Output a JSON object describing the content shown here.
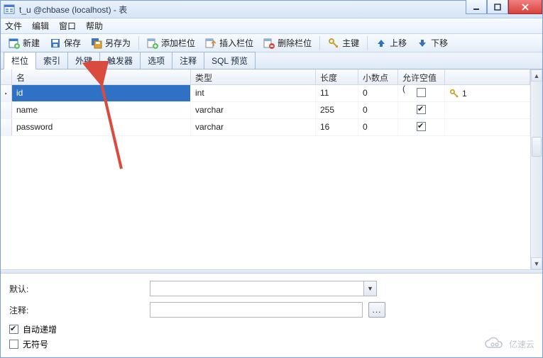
{
  "window": {
    "title": "t_u @chbase (localhost) - 表"
  },
  "menu": {
    "file": "文件",
    "edit": "编辑",
    "window": "窗口",
    "help": "帮助"
  },
  "toolbar": {
    "new": "新建",
    "save": "保存",
    "saveas": "另存为",
    "addcol": "添加栏位",
    "insertcol": "插入栏位",
    "delcol": "删除栏位",
    "pkey": "主键",
    "moveup": "上移",
    "movedown": "下移"
  },
  "tabs": {
    "fields": "栏位",
    "indexes": "索引",
    "fks": "外键",
    "triggers": "触发器",
    "options": "选项",
    "comment": "注释",
    "sqlpreview": "SQL 预览",
    "active": "fields"
  },
  "grid": {
    "headers": {
      "name": "名",
      "type": "类型",
      "length": "长度",
      "decimals": "小数点",
      "allownull": "允许空值 (",
      "key": ""
    },
    "rows": [
      {
        "name": "id",
        "type": "int",
        "length": "11",
        "decimals": "0",
        "allownull": false,
        "pk": "1",
        "selected": true
      },
      {
        "name": "name",
        "type": "varchar",
        "length": "255",
        "decimals": "0",
        "allownull": true,
        "pk": "",
        "selected": false
      },
      {
        "name": "password",
        "type": "varchar",
        "length": "16",
        "decimals": "0",
        "allownull": true,
        "pk": "",
        "selected": false
      }
    ]
  },
  "form": {
    "default_label": "默认:",
    "default_value": "",
    "comment_label": "注释:",
    "comment_value": "",
    "autoinc_label": "自动递增",
    "autoinc": true,
    "unsigned_label": "无符号",
    "unsigned": false,
    "more": "..."
  },
  "watermark": "亿速云"
}
